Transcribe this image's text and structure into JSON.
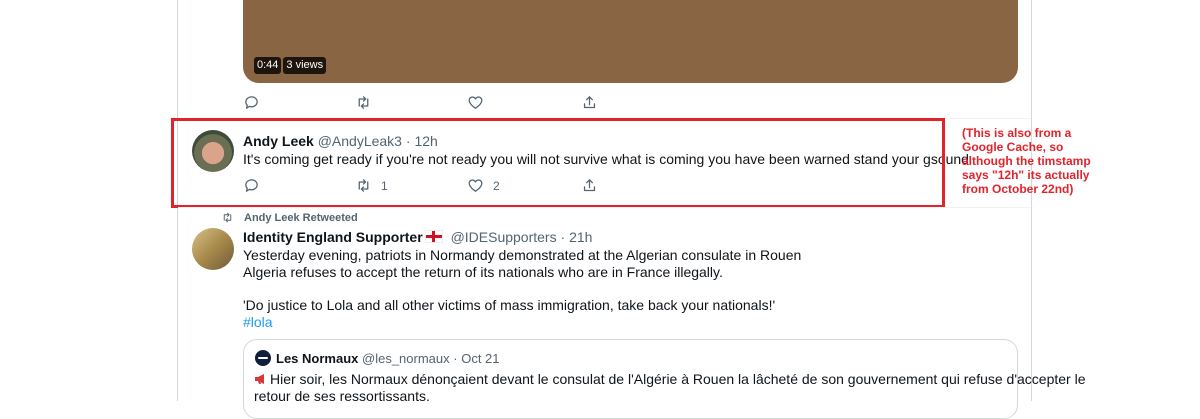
{
  "video": {
    "duration": "0:44",
    "views": "3 views"
  },
  "video_tweet_actions": {
    "replies": "",
    "retweets": "",
    "likes": ""
  },
  "tweet1": {
    "name": "Andy Leek",
    "handle": "@AndyLeak3",
    "sep": "·",
    "time": "12h",
    "text": "It's coming get ready if you're not ready you will not survive what is coming you have been warned stand your gsound",
    "replies": "",
    "retweets": "1",
    "likes": "2"
  },
  "annotation": {
    "text": "(This is also from a Google Cache, so although the timstamp says \"12h\" its actually from October 22nd)",
    "color": "#e3232b"
  },
  "retweet_row": {
    "label": "Andy Leek Retweeted"
  },
  "tweet2": {
    "name": "Identity England Supporter",
    "handle": "@IDESupporters",
    "sep": "·",
    "time": "21h",
    "line1": "Yesterday evening, patriots in Normandy demonstrated at the Algerian consulate in Rouen",
    "line2": "Algeria refuses to accept the return of its nationals who are in France illegally.",
    "line3": "'Do justice to Lola and all other victims of mass immigration, take back your nationals!'",
    "hashtag": "#lola"
  },
  "quote": {
    "name": "Les Normaux",
    "handle": "@les_normaux",
    "sep": "·",
    "time": "Oct 21",
    "line1": "Hier soir, les Normaux dénonçaient devant le consulat de l'Algérie à Rouen la lâcheté de son gouvernement qui refuse d'accepter le",
    "line2": "retour de ses ressortissants."
  },
  "icons": [
    "reply-icon",
    "retweet-icon",
    "like-icon",
    "share-icon",
    "megaphone-icon",
    "england-flag-icon"
  ],
  "colors": {
    "link": "#1d9bf0",
    "muted": "#536471",
    "highlight": "#e3232b",
    "video_bg": "#8a6543"
  }
}
